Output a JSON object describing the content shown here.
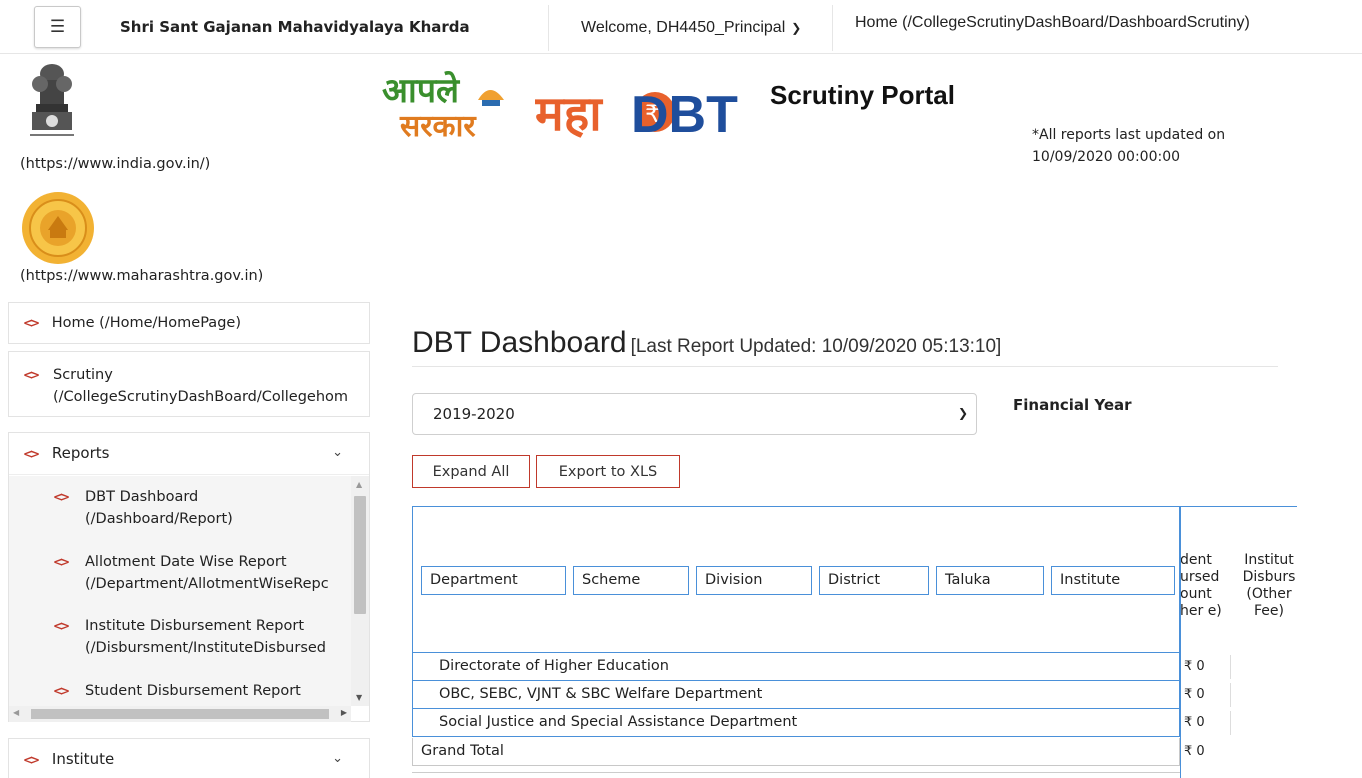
{
  "topbar": {
    "menu_icon": "hamburger-icon",
    "college_name": "Shri Sant Gajanan Mahavidyalaya Kharda",
    "welcome": "Welcome, DH4450_Principal",
    "home_link": "Home (/CollegeScrutinyDashBoard/DashboardScrutiny)"
  },
  "links": {
    "india": "(https://www.india.gov.in/)",
    "maharashtra": "(https://www.maharashtra.gov.in)"
  },
  "header": {
    "aaple_logo_top": "आपले",
    "aaple_logo_bottom": "सरकार",
    "maha_logo_text": "महा",
    "maha_logo_dbt": "DBT",
    "portal_title": "Scrutiny Portal",
    "report_note": "*All reports last updated on 10/09/2020 00:00:00"
  },
  "sidebar": {
    "home": "Home (/Home/HomePage)",
    "scrutiny_line1": "Scrutiny",
    "scrutiny_line2": "(/CollegeScrutinyDashBoard/Collegehom",
    "reports": "Reports",
    "reports_items": [
      {
        "line1": "DBT Dashboard",
        "line2": "(/Dashboard/Report)"
      },
      {
        "line1": "Allotment Date Wise Report",
        "line2": "(/Department/AllotmentWiseRepc"
      },
      {
        "line1": "Institute Disbursement Report",
        "line2": "(/Disbursment/InstituteDisbursed"
      },
      {
        "line1": "Student Disbursement Report",
        "line2": ""
      }
    ],
    "institute": "Institute"
  },
  "main": {
    "title": "DBT Dashboard",
    "subtitle": "[Last Report Updated: 10/09/2020 05:13:10]",
    "fy_value": "2019-2020",
    "fy_label": "Financial Year",
    "expand_all": "Expand All",
    "export_xls": "Export to XLS"
  },
  "table": {
    "filters": [
      "Department",
      "Scheme",
      "Division",
      "District",
      "Taluka",
      "Institute"
    ],
    "col1_header": "dent ursed ount her e)",
    "col2_header": "Institut Disburs (Other Fee)",
    "rows": [
      {
        "name": "Directorate of Higher Education",
        "amount": "₹ 0"
      },
      {
        "name": "OBC, SEBC, VJNT & SBC Welfare Department",
        "amount": "₹ 0"
      },
      {
        "name": "Social Justice and Special Assistance Department",
        "amount": "₹ 0"
      }
    ],
    "grand_total_label": "Grand Total",
    "grand_total_amount": "₹ 0"
  }
}
